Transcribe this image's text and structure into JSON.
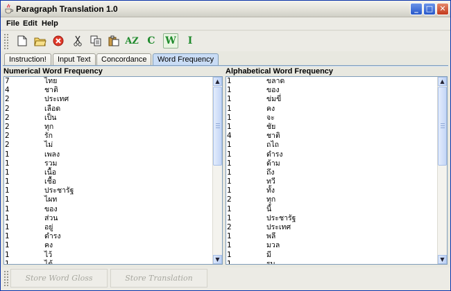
{
  "window": {
    "title": "Paragraph Translation 1.0"
  },
  "menu": [
    "File",
    "Edit",
    "Help"
  ],
  "toolbar": {
    "az_label": "AZ",
    "c_label": "C",
    "w_label": "W",
    "i_label": "I",
    "accent_green": "#1f8a2c"
  },
  "tabs": [
    {
      "label": "Instruction!",
      "active": false
    },
    {
      "label": "Input Text",
      "active": false
    },
    {
      "label": "Concordance",
      "active": false
    },
    {
      "label": "Word Frequency",
      "active": true
    }
  ],
  "numerical": {
    "title": "Numerical Word Frequency",
    "rows": [
      {
        "count": "7",
        "word": "ไทย"
      },
      {
        "count": "4",
        "word": "ชาติ"
      },
      {
        "count": "2",
        "word": "ประเทศ"
      },
      {
        "count": "2",
        "word": "เลือด"
      },
      {
        "count": "2",
        "word": "เป็น"
      },
      {
        "count": "2",
        "word": "ทุก"
      },
      {
        "count": "2",
        "word": "รัก"
      },
      {
        "count": "2",
        "word": "ไม่"
      },
      {
        "count": "1",
        "word": "เพลง"
      },
      {
        "count": "1",
        "word": "รวม"
      },
      {
        "count": "1",
        "word": "เนื้อ"
      },
      {
        "count": "1",
        "word": "เชื้อ"
      },
      {
        "count": "1",
        "word": "ประชารัฐ"
      },
      {
        "count": "1",
        "word": "ไผท"
      },
      {
        "count": "1",
        "word": "ของ"
      },
      {
        "count": "1",
        "word": "ส่วน"
      },
      {
        "count": "1",
        "word": "อยู่"
      },
      {
        "count": "1",
        "word": "ดำรง"
      },
      {
        "count": "1",
        "word": "คง"
      },
      {
        "count": "1",
        "word": "ไว้"
      },
      {
        "count": "1",
        "word": "ได้"
      }
    ]
  },
  "alphabetical": {
    "title": "Alphabetical Word Frequency",
    "rows": [
      {
        "count": "1",
        "word": "ขลาด"
      },
      {
        "count": "1",
        "word": "ของ"
      },
      {
        "count": "1",
        "word": "ข่มขี่"
      },
      {
        "count": "1",
        "word": "คง"
      },
      {
        "count": "1",
        "word": "จะ"
      },
      {
        "count": "1",
        "word": "ชัย"
      },
      {
        "count": "4",
        "word": "ชาติ"
      },
      {
        "count": "1",
        "word": "ถไถ"
      },
      {
        "count": "1",
        "word": "ดำรง"
      },
      {
        "count": "1",
        "word": "ด้าม"
      },
      {
        "count": "1",
        "word": "ถึง"
      },
      {
        "count": "1",
        "word": "ทวี"
      },
      {
        "count": "1",
        "word": "ทั้ง"
      },
      {
        "count": "2",
        "word": "ทุก"
      },
      {
        "count": "1",
        "word": "นี้"
      },
      {
        "count": "1",
        "word": "ประชารัฐ"
      },
      {
        "count": "2",
        "word": "ประเทศ"
      },
      {
        "count": "1",
        "word": "พลี"
      },
      {
        "count": "1",
        "word": "มวล"
      },
      {
        "count": "1",
        "word": "มี"
      },
      {
        "count": "1",
        "word": "รบ"
      }
    ]
  },
  "bottom": {
    "store_gloss": "Store Word Gloss",
    "store_translation": "Store Translation"
  }
}
